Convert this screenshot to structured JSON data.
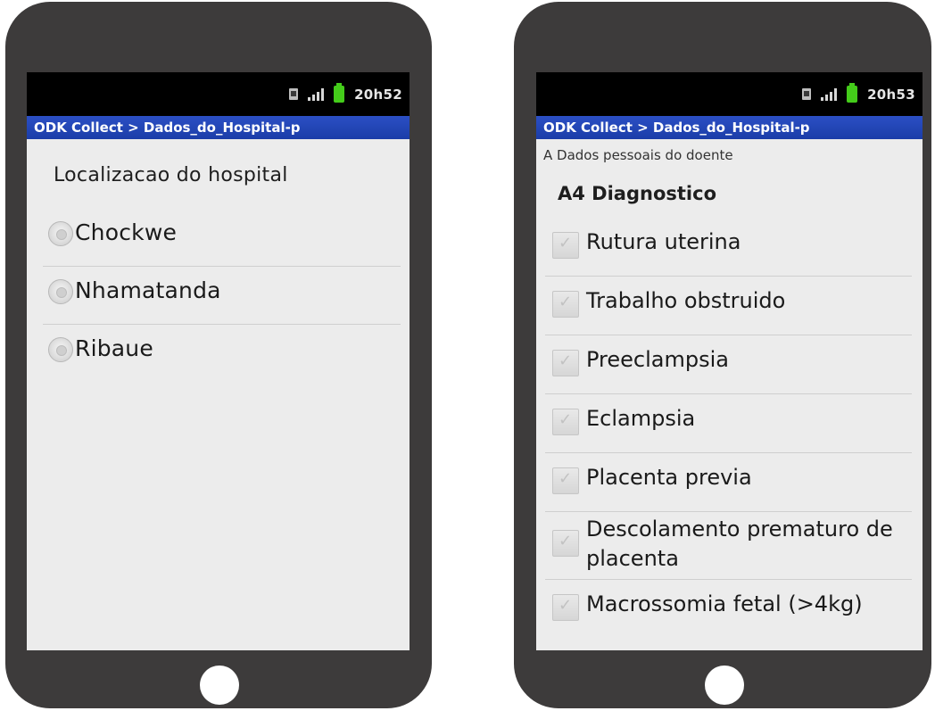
{
  "left_phone": {
    "status_time": "20h52",
    "app_title": "ODK Collect > Dados_do_Hospital-p",
    "question": "Localizacao do hospital",
    "options": [
      {
        "label": "Chockwe"
      },
      {
        "label": "Nhamatanda"
      },
      {
        "label": "Ribaue"
      }
    ]
  },
  "right_phone": {
    "status_time": "20h53",
    "app_title": "ODK Collect > Dados_do_Hospital-p",
    "group_label": "A Dados pessoais do doente",
    "question": "A4 Diagnostico",
    "options": [
      {
        "label": "Rutura uterina"
      },
      {
        "label": "Trabalho obstruido"
      },
      {
        "label": "Preeclampsia"
      },
      {
        "label": "Eclampsia"
      },
      {
        "label": "Placenta previa"
      },
      {
        "label": "Descolamento prematuro de placenta"
      },
      {
        "label": "Macrossomia fetal (>4kg)"
      }
    ]
  },
  "icons": {
    "status_bar": [
      "sim-card-icon",
      "signal-strength-icon",
      "battery-icon"
    ],
    "radio": "radio-button-icon",
    "checkbox": "checkbox-icon",
    "home": "home-button"
  },
  "colors": {
    "phone_body": "#3d3b3b",
    "title_bar": "#1b3da8",
    "screen_bg": "#ececec",
    "battery": "#44cc1a"
  }
}
